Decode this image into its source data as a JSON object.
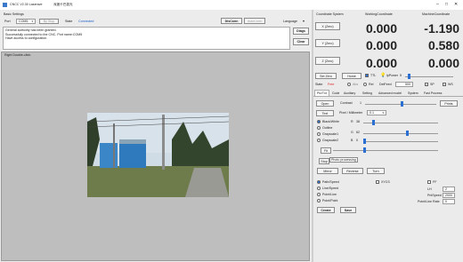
{
  "window": {
    "title": "CNCC V2.30  Laserave",
    "subtitle": "深度卡巴激光",
    "controls": [
      "–",
      "□",
      "✕"
    ]
  },
  "left": {
    "tab_label": "Basic Settings",
    "port_label": "Port",
    "port_value": "COM5",
    "stop_button": "By Stop",
    "state_label": "State",
    "state_value": "Connected",
    "dis_conn_button": "DisConn",
    "auto_conn_button": "AutoConn",
    "language_label": "Language",
    "log_lines": [
      "General authority has been granted.",
      "Successfully connected to the CNC. Port name:COM5",
      "Have access to configuration."
    ],
    "diags_button": "Diags",
    "clear_button": "Clear",
    "canvas_hint": "Right Double-click:"
  },
  "coords": {
    "header": [
      "Coordinate System",
      "WorkingCoordinate",
      "MachineCoordinate"
    ],
    "rows": [
      {
        "button": "X (Zero)",
        "work": "0.000",
        "machine": "-1.190"
      },
      {
        "button": "Y (Zero)",
        "work": "0.000",
        "machine": "0.580"
      },
      {
        "button": "Z (Zero)",
        "work": "0.000",
        "machine": "0.000"
      }
    ]
  },
  "controls_row1": {
    "set_zero": "Set Zero",
    "home": "Home",
    "ttl_label": "TTL",
    "lpower_label": "lpPower",
    "lpower_value": "5"
  },
  "controls_row2": {
    "state_label": "State",
    "state_value": "Free",
    "options": [
      "Abs",
      "Rel"
    ],
    "delfeed_label": "DelFeed",
    "delfeed_value": "500",
    "sp_label": "SP",
    "ws_label": "WS"
  },
  "tabs": [
    "Pic/Txt",
    "Code",
    "Auxiliary",
    "Setting",
    "Advanced model",
    "System",
    "Fast Process"
  ],
  "pic_tab": {
    "open_button": "Open",
    "contrast_label": "Contrast",
    "contrast_value": "1",
    "print_button": "Prints",
    "text_button": "Text",
    "pixel_label": "Pixel / Millimeter",
    "pixel_value": "0.1",
    "mode_options": [
      "Black/White",
      "Outline",
      "Grayscale1",
      "Grayscale2"
    ],
    "rgb": [
      {
        "label": "R",
        "value": "38"
      },
      {
        "label": "G",
        "value": "62"
      },
      {
        "label": "B",
        "value": "0"
      }
    ],
    "fit_button": "Fit",
    "stop_button": "Stop",
    "tooltip": "Photo processing",
    "mirror_button": "Mirror",
    "reverse_button": "Reverse",
    "turn_button": "Turn",
    "path_options": [
      "Path/Speed",
      "Line/Speed",
      "Point/Line",
      "Point/Point"
    ],
    "xycs_label": "XYCS",
    "ff_label": "FF",
    "lh_label": "LH",
    "lh_value": "2",
    "pnt_speed_label": "PntSpeed",
    "pnt_speed_value": "2000",
    "pnt_line_rate_label": "Point/Line Rate",
    "pnt_line_rate_value": "0",
    "create_button": "Create",
    "save_button": "Save"
  }
}
